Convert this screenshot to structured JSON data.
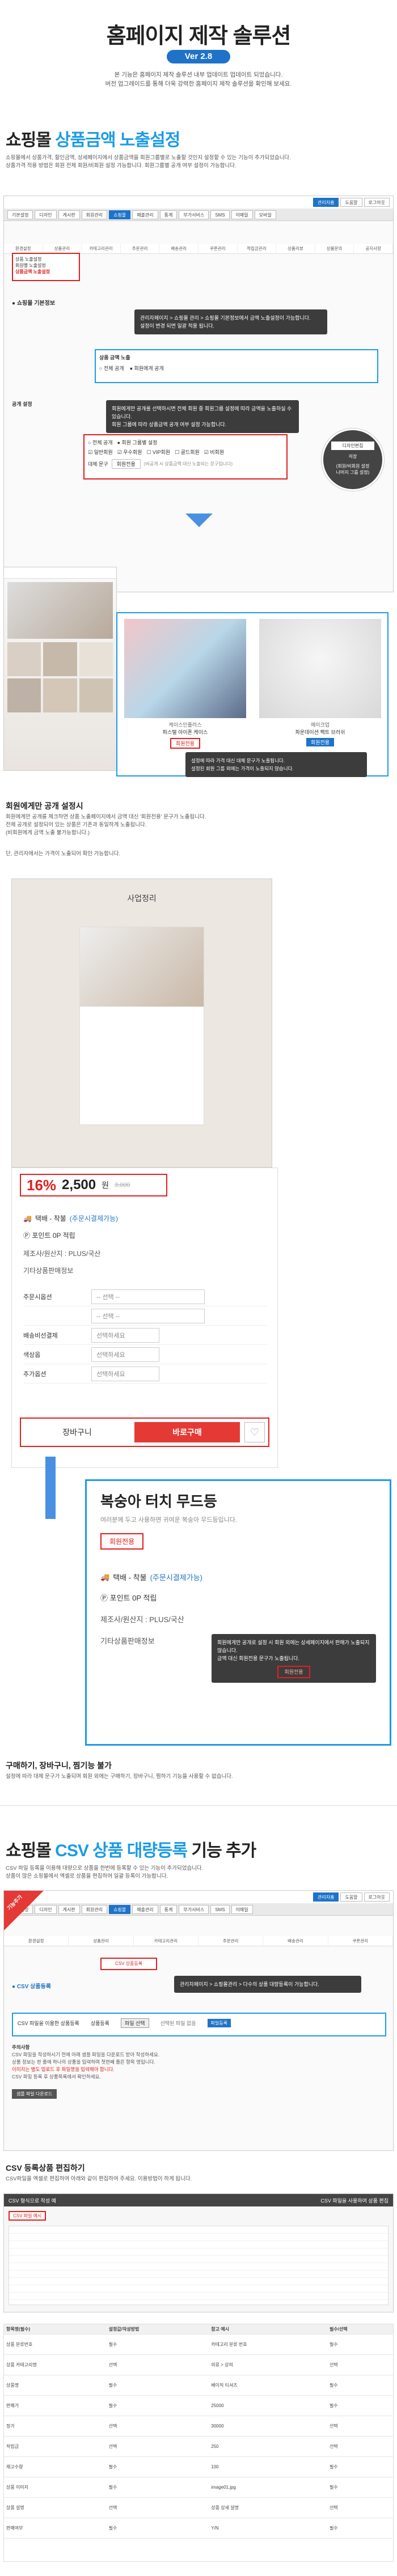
{
  "header": {
    "title": "홈페이지 제작 솔루션",
    "version": "Ver 2.8",
    "intro_line1": "본 기능은 홈페이지 제작 솔루션 내부 업데이트 업데이트 되었습니다.",
    "intro_line2": "버전 업그레이드를 통해 더욱 강력한 홈페이지 제작 솔루션을 확인해 보세요."
  },
  "section1": {
    "title_prefix": "쇼핑몰",
    "title_highlight": "상품금액 노출설정",
    "desc1": "쇼핑몰에서 상품가격, 할인금액, 상세페이지에서 상품금액을 회원그룹별로 노출할 것인지 설정할 수 있는 기능이 추가되었습니다.",
    "desc2": "상품가격 적용 방법은 회원 전체 회원/비회원 설정 가능합니다. 회원그룹별 공개 여부 설정이 가능합니다.",
    "admin_tabs": [
      "기본설정",
      "디자인",
      "게시판",
      "회원관리",
      "쇼핑몰",
      "매출관리",
      "통계",
      "부가서비스",
      "SMS",
      "이메일",
      "모바일"
    ],
    "admin_tabs_right": [
      "관리자홈",
      "도움말",
      "로그아웃"
    ],
    "menu_items": [
      "환경설정",
      "상품관리",
      "카테고리관리",
      "주문관리",
      "배송관리",
      "쿠폰관리",
      "적립금관리",
      "상품리뷰",
      "상품문의",
      "공지사항"
    ],
    "sub_menu": [
      "상품 노출설정",
      "회원별 노출설정",
      "상품금액 노출설정"
    ],
    "breadcrumb": "관리자페이지 > 쇼핑몰 관리 > 쇼핑몰 기본정보에서 금액 노출설정이 가능합니다.",
    "breadcrumb2": "설정이 변경 되면 일괄 적용 됩니다.",
    "setting_label": "쇼핑몰 기본정보",
    "price_label": "상품 금액 노출",
    "radio_all": "전체 공개",
    "radio_member": "회원에게 공개",
    "radio_group": "회원 그룹별 설정",
    "group_label": "공개 설정",
    "notice_dark1": "회원에게만 공개를 선택하시면 전체 회원 중 회원그룹 설정에 따라 금액을 노출하실 수 있습니다.",
    "notice_dark2": "회원 그룹에 따라 상품금액 공개 여부 설정 가능합니다.",
    "checkbox_options": [
      "일반회원",
      "우수회원",
      "VIP회원",
      "골드회원",
      "비회원"
    ],
    "replace_label": "대체 문구",
    "replace_value": "회원전용",
    "replace_hint": "(비공개 시 상품금액 대신 노출되는 문구입니다)",
    "zoom_tag1": "디자인편집",
    "zoom_tag2": "저장",
    "zoom_tag3": "(회원/비회원 설정",
    "zoom_tag4": "나머지 그룹 설정)",
    "product_card1": {
      "brand": "케이스인플러스",
      "name": "파스텔 아이폰 케이스",
      "price": "회원전용"
    },
    "product_card2": {
      "brand": "메이크업",
      "name": "파운데이션 팩트 브러쉬",
      "price": "회원전용"
    },
    "card_notice1": "설정에 따라 가격 대신 대체 문구가 노출됩니다.",
    "card_notice2": "설정된 회원 그룹 외에는 가격이 노출되지 않습니다.",
    "sub_title": "회원에게만 공개 설정시",
    "sub_desc1": "회원에게만 공개를 체크하면 상품 노출페이지에서 금액 대신 '회원전용' 문구가 노출됩니다.",
    "sub_desc2": "전체 공개로 설정되어 있는 상품은 기존과 동일하게 노출됩니다.",
    "sub_desc3": "(비회원에게 금액 노출 불가능합니다.)",
    "note": "단, 관리자에서는 가격이 노출되어 확인 가능합니다."
  },
  "detail_page": {
    "shop_title": "사업정리",
    "discount": "16%",
    "price": "2,500",
    "price_unit": "원",
    "orig_price": "3,000",
    "shipping_label": "택배 - 착불",
    "shipping_note": "(주문시결제가능)",
    "point": "포인트 0P 적립",
    "maker": "제조사/원산지 : PLUS/국산",
    "extra": "기타상품판매정보",
    "options": [
      {
        "label": "주문시옵션",
        "value": "-- 선택 --"
      },
      {
        "label": "",
        "value": "-- 선택 --"
      },
      {
        "label": "배송비선결제",
        "value": "선택하세요"
      },
      {
        "label": "색상옵",
        "value": "선택하세요"
      },
      {
        "label": "추가옵션",
        "value": "선택하세요"
      }
    ],
    "cart": "장바구니",
    "buy": "바로구매",
    "overlay_title": "복숭아 터치 무드등",
    "overlay_sub": "여러분께 두고 사용하면 귀여운 복숭아 무드등입니다.",
    "overlay_badge": "회원전용",
    "overlay_popup1": "회원에게만 공개로 설정 시 회원 외에는 상세페이지에서 판매가 노출되지 않습니다.",
    "overlay_popup2": "금액 대신 회원전용 문구가 노출됩니다.",
    "overlay_popup_badge": "회원전용",
    "bottom_title": "구매하기, 장바구니, 찜기능 불가",
    "bottom_desc": "설정에 따라 대체 문구가 노출되며 회원 외에는 구매하기, 장바구니, 찜하기 기능을 사용할 수 없습니다."
  },
  "section2": {
    "title_prefix": "쇼핑몰",
    "title_highlight": "CSV 상품 대량등록",
    "title_suffix": "기능 추가",
    "desc1": "CSV 파일 등록을 이용해 대량으로 상품을 한번에 등록할 수 있는 기능이 추가되었습니다.",
    "desc2": "상품이 많은 쇼핑몰에서 엑셀로 상품을 편집하여 일괄 등록이 가능합니다.",
    "badge": "기능추가",
    "csv_label": "CSV 상품등록",
    "csv_file_label": "CSV 파일을 이용한 상품등록",
    "csv_upload_label": "상품등록",
    "csv_choose": "파일 선택",
    "csv_none": "선택된 파일 없음",
    "csv_btn": "파일등록",
    "csv_path": "관리자페이지 > 쇼핑몰관리 > 다수의 상품 대량등록이 가능합니다.",
    "csv_notes_title": "주의사항",
    "csv_notes": [
      "CSV 파일을 작성하시기 전에 아래 샘플 파일을 다운로드 받아 작성하세요.",
      "상품 정보는 한 줄에 하나의 상품을 입력하며 첫번째 줄은 항목 명입니다.",
      "이미지는 별도 업로드 후 파일명을 입력해야 합니다.",
      "CSV 파일 등록 후 상품목록에서 확인하세요."
    ],
    "sample_btn": "샘플 파일 다운로드",
    "edit_title": "CSV 등록상품 편집하기",
    "edit_desc": "CSV파일을 엑셀로 편집하여 아래와 같이 편집하여 주세요. 이용방법이 하게 됩니다.",
    "edit_header": "CSV 형식으로 작성 예",
    "edit_header_right": "CSV 파일을 사용하여 상품 편집",
    "edit_tag": "CSV 파일 예시",
    "columns": [
      "항목명(필수)",
      "설정값/작성방법",
      "참고 예시",
      "필수/선택"
    ],
    "rows": [
      [
        "상품 분류번호",
        "필수",
        "카테고리 분류 번호",
        "필수"
      ],
      [
        "상품 카테고리명",
        "선택",
        "의류 > 상의",
        "선택"
      ],
      [
        "상품명",
        "필수",
        "베이직 티셔츠",
        "필수"
      ],
      [
        "판매가",
        "필수",
        "25000",
        "필수"
      ],
      [
        "정가",
        "선택",
        "30000",
        "선택"
      ],
      [
        "적립금",
        "선택",
        "250",
        "선택"
      ],
      [
        "재고수량",
        "필수",
        "100",
        "필수"
      ],
      [
        "상품 이미지",
        "필수",
        "image01.jpg",
        "필수"
      ],
      [
        "상품 설명",
        "선택",
        "상품 상세 설명",
        "선택"
      ],
      [
        "판매여부",
        "필수",
        "Y/N",
        "필수"
      ]
    ]
  },
  "colors": {
    "accent": "#1b9be6",
    "brand": "#1e73c8",
    "red": "#e02020",
    "dark": "#3c3c3c"
  }
}
